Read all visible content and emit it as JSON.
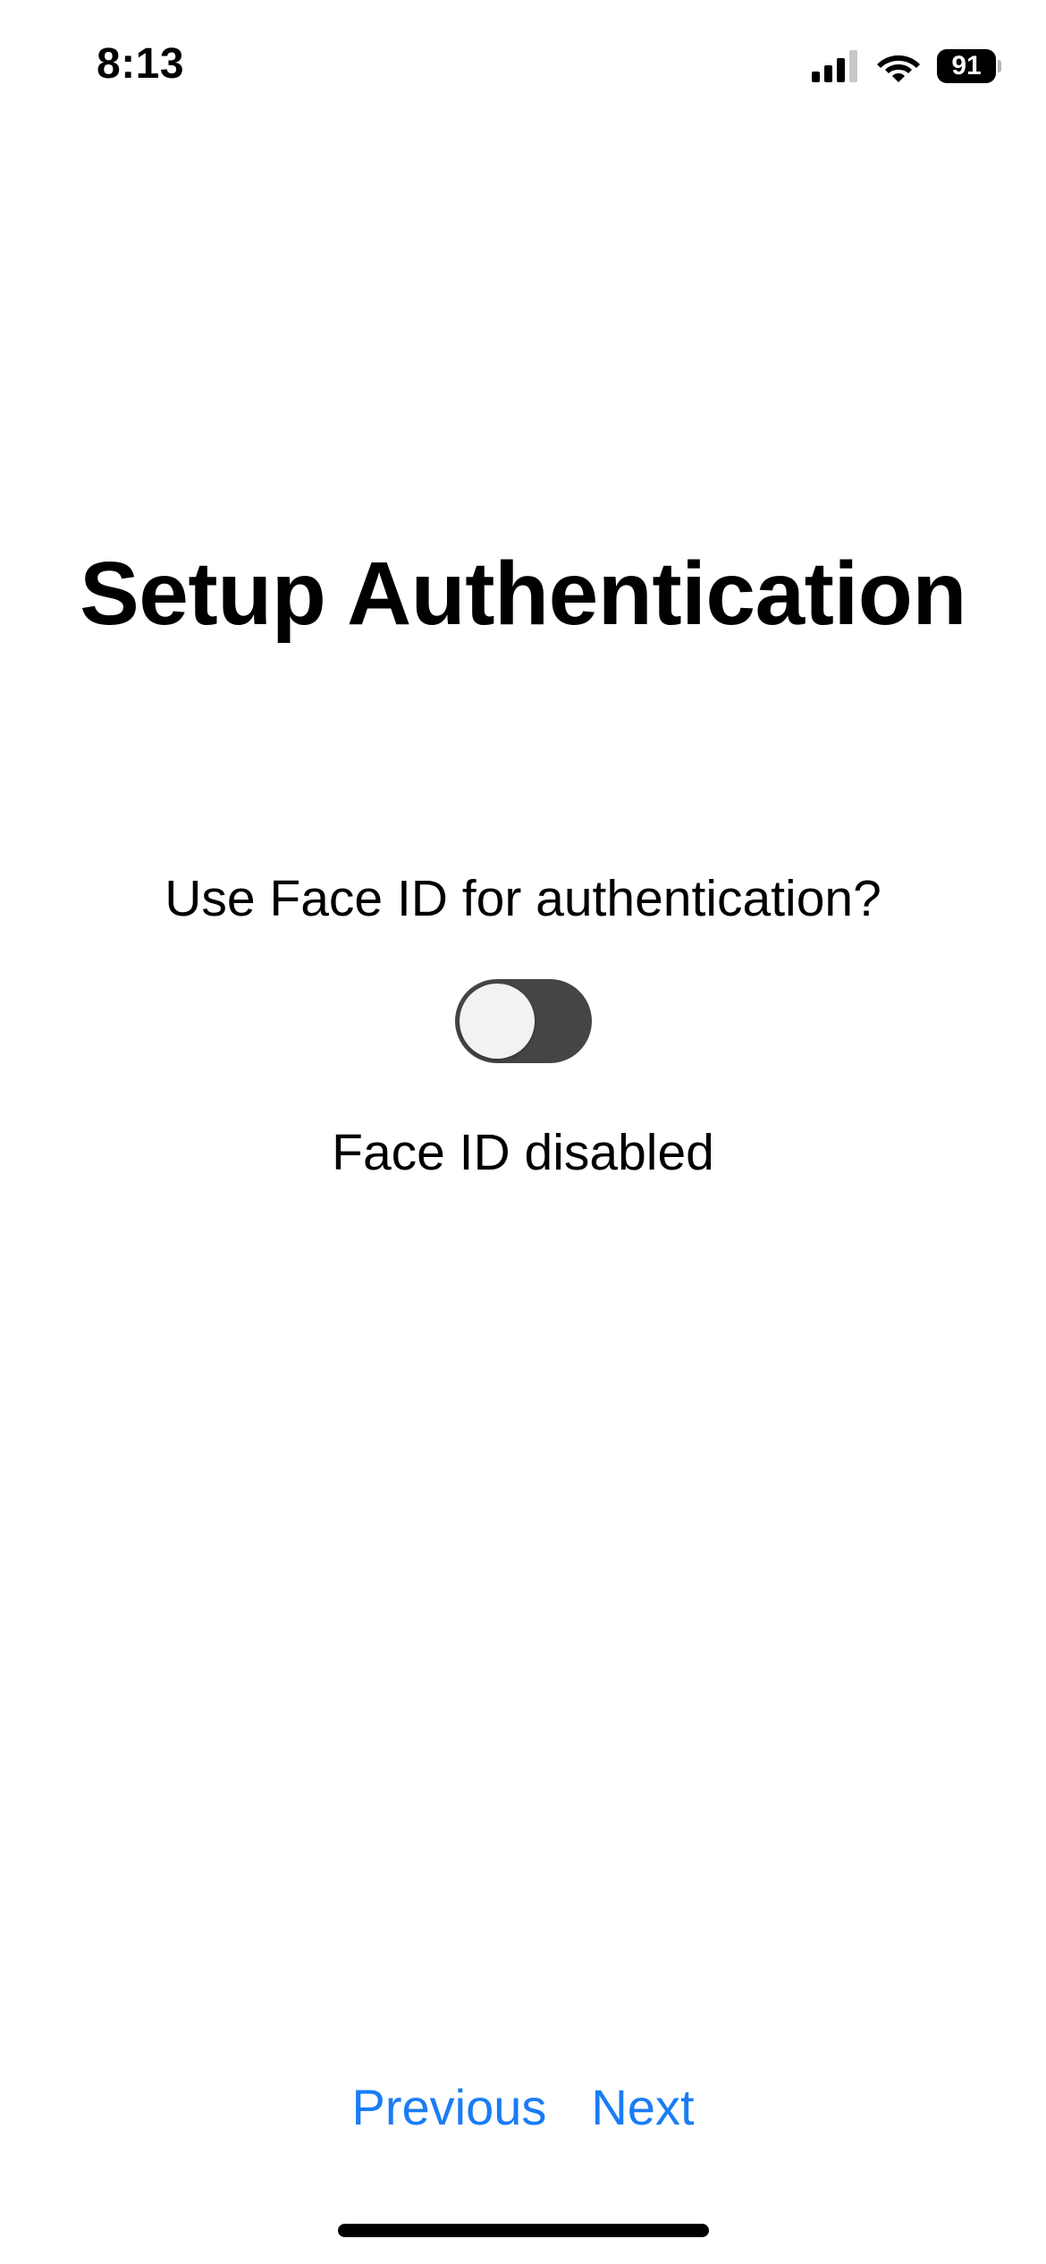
{
  "status_bar": {
    "time": "8:13",
    "icons": [
      "cellular-signal-icon",
      "wifi-icon",
      "battery-icon"
    ],
    "battery_level": "91"
  },
  "title": "Setup Authentication",
  "face_id": {
    "question": "Use Face ID for authentication?",
    "toggle_on": false,
    "status": "Face ID disabled"
  },
  "navigation": {
    "previous_label": "Previous",
    "next_label": "Next"
  },
  "colors": {
    "accent": "#1a7cf5",
    "toggle_off_track": "#454545",
    "toggle_knob": "#f2f2f2"
  }
}
